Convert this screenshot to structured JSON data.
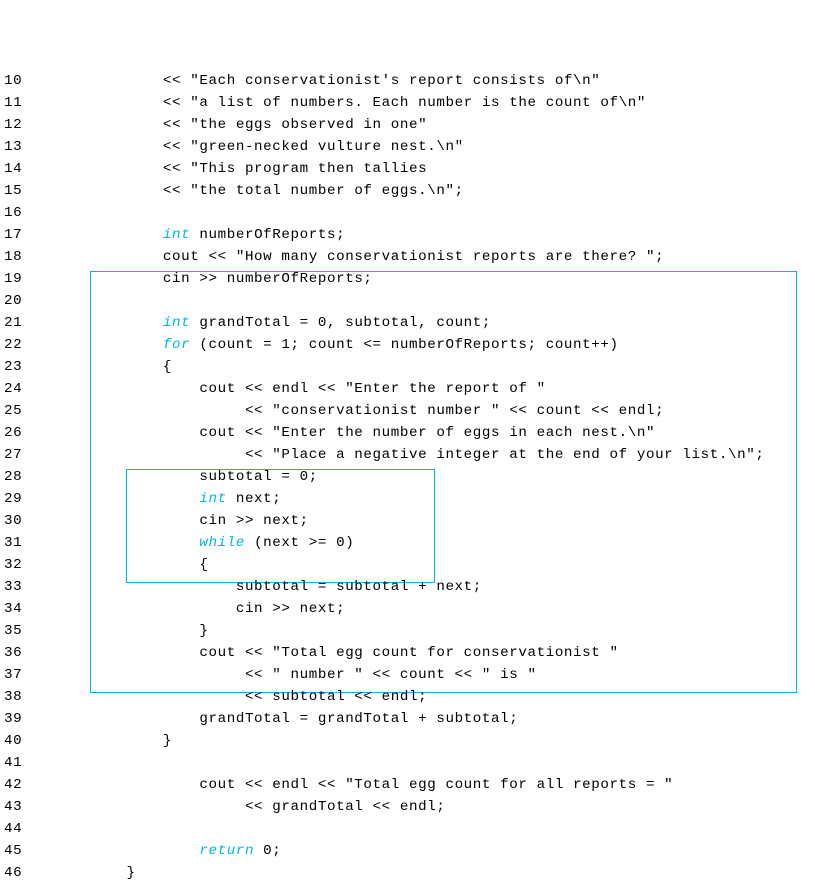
{
  "lines": [
    {
      "num": "10",
      "indent": 2,
      "seg": [
        {
          "t": "<< \"Each conservationist's report consists of\\n\""
        }
      ]
    },
    {
      "num": "11",
      "indent": 2,
      "seg": [
        {
          "t": "<< \"a list of numbers. Each number is the count of\\n\""
        }
      ]
    },
    {
      "num": "12",
      "indent": 2,
      "seg": [
        {
          "t": "<< \"the eggs observed in one\""
        }
      ]
    },
    {
      "num": "13",
      "indent": 2,
      "seg": [
        {
          "t": "<< \"green-necked vulture nest.\\n\""
        }
      ]
    },
    {
      "num": "14",
      "indent": 2,
      "seg": [
        {
          "t": "<< \"This program then tallies"
        }
      ]
    },
    {
      "num": "15",
      "indent": 2,
      "seg": [
        {
          "t": "<< \"the total number of eggs.\\n\";"
        }
      ]
    },
    {
      "num": "16",
      "indent": 0,
      "seg": [
        {
          "t": ""
        }
      ]
    },
    {
      "num": "17",
      "indent": 2,
      "seg": [
        {
          "t": "int",
          "c": "kw"
        },
        {
          "t": " numberOfReports;"
        }
      ]
    },
    {
      "num": "18",
      "indent": 2,
      "seg": [
        {
          "t": "cout << \"How many conservationist reports are there? \";"
        }
      ]
    },
    {
      "num": "19",
      "indent": 2,
      "seg": [
        {
          "t": "cin >> numberOfReports;"
        }
      ]
    },
    {
      "num": "20",
      "indent": 0,
      "seg": [
        {
          "t": ""
        }
      ]
    },
    {
      "num": "21",
      "indent": 2,
      "seg": [
        {
          "t": "int",
          "c": "kw"
        },
        {
          "t": " grandTotal = 0, subtotal, count;"
        }
      ]
    },
    {
      "num": "22",
      "indent": 2,
      "seg": [
        {
          "t": "for",
          "c": "kw"
        },
        {
          "t": " (count = 1; count <= numberOfReports; count++)"
        }
      ]
    },
    {
      "num": "23",
      "indent": 2,
      "seg": [
        {
          "t": "{"
        }
      ]
    },
    {
      "num": "24",
      "indent": 3,
      "seg": [
        {
          "t": "cout << endl << \"Enter the report of \""
        }
      ]
    },
    {
      "num": "25",
      "indent": 4,
      "seg": [
        {
          "t": " << \"conservationist number \" << count << endl;"
        }
      ]
    },
    {
      "num": "26",
      "indent": 3,
      "seg": [
        {
          "t": "cout << \"Enter the number of eggs in each nest.\\n\""
        }
      ]
    },
    {
      "num": "27",
      "indent": 4,
      "seg": [
        {
          "t": " << \"Place a negative integer at the end of your list.\\n\";"
        }
      ]
    },
    {
      "num": "28",
      "indent": 3,
      "seg": [
        {
          "t": "subtotal = 0;"
        }
      ]
    },
    {
      "num": "29",
      "indent": 3,
      "seg": [
        {
          "t": "int",
          "c": "kw"
        },
        {
          "t": " next;"
        }
      ]
    },
    {
      "num": "30",
      "indent": 3,
      "seg": [
        {
          "t": "cin >> next;"
        }
      ]
    },
    {
      "num": "31",
      "indent": 3,
      "seg": [
        {
          "t": "while",
          "c": "kw"
        },
        {
          "t": " (next >= 0)"
        }
      ]
    },
    {
      "num": "32",
      "indent": 3,
      "seg": [
        {
          "t": "{"
        }
      ]
    },
    {
      "num": "33",
      "indent": 4,
      "seg": [
        {
          "t": "subtotal = subtotal + next;"
        }
      ]
    },
    {
      "num": "34",
      "indent": 4,
      "seg": [
        {
          "t": "cin >> next;"
        }
      ]
    },
    {
      "num": "35",
      "indent": 3,
      "seg": [
        {
          "t": "}"
        }
      ]
    },
    {
      "num": "36",
      "indent": 3,
      "seg": [
        {
          "t": "cout << \"Total egg count for conservationist \""
        }
      ]
    },
    {
      "num": "37",
      "indent": 4,
      "seg": [
        {
          "t": " << \" number \" << count << \" is \""
        }
      ]
    },
    {
      "num": "38",
      "indent": 4,
      "seg": [
        {
          "t": " << subtotal << endl;"
        }
      ]
    },
    {
      "num": "39",
      "indent": 3,
      "seg": [
        {
          "t": "grandTotal = grandTotal + subtotal;"
        }
      ]
    },
    {
      "num": "40",
      "indent": 2,
      "seg": [
        {
          "t": "}"
        }
      ]
    },
    {
      "num": "41",
      "indent": 0,
      "seg": [
        {
          "t": ""
        }
      ]
    },
    {
      "num": "42",
      "indent": 3,
      "seg": [
        {
          "t": "cout << endl << \"Total egg count for all reports = \""
        }
      ]
    },
    {
      "num": "43",
      "indent": 4,
      "seg": [
        {
          "t": " << grandTotal << endl;"
        }
      ]
    },
    {
      "num": "44",
      "indent": 0,
      "seg": [
        {
          "t": ""
        }
      ]
    },
    {
      "num": "45",
      "indent": 3,
      "seg": [
        {
          "t": "return",
          "c": "kw"
        },
        {
          "t": " 0;"
        }
      ]
    },
    {
      "num": "46",
      "indent": 1,
      "seg": [
        {
          "t": "}"
        }
      ]
    }
  ],
  "indent_units": [
    "",
    "    ",
    "        ",
    "            ",
    "                "
  ]
}
